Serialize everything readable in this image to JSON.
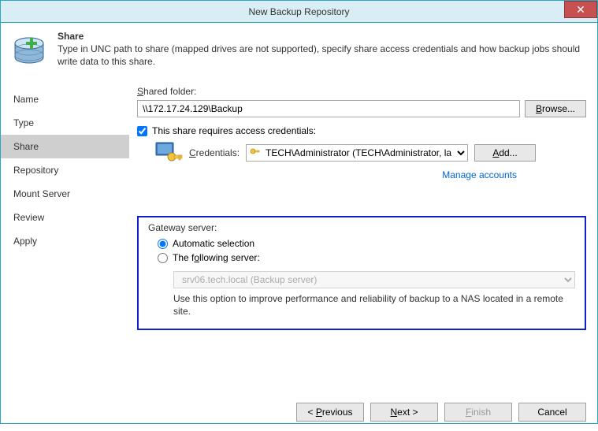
{
  "window": {
    "title": "New Backup Repository",
    "close": "✕"
  },
  "header": {
    "title": "Share",
    "description": "Type in UNC path to share (mapped drives are not supported), specify share access credentials and how backup jobs should write data to this share."
  },
  "sidebar": {
    "items": [
      {
        "label": "Name"
      },
      {
        "label": "Type"
      },
      {
        "label": "Share"
      },
      {
        "label": "Repository"
      },
      {
        "label": "Mount Server"
      },
      {
        "label": "Review"
      },
      {
        "label": "Apply"
      }
    ],
    "active_index": 2
  },
  "form": {
    "shared_folder_label": "Shared folder:",
    "shared_folder_value": "\\\\172.17.24.129\\Backup",
    "browse_label": "Browse...",
    "checkbox_label": "This share requires access credentials:",
    "checkbox_checked": true,
    "credentials_label": "Credentials:",
    "credentials_value": "TECH\\Administrator (TECH\\Administrator, last edite",
    "add_label": "Add...",
    "manage_label": "Manage accounts"
  },
  "gateway": {
    "title": "Gateway server:",
    "auto_label": "Automatic selection",
    "following_label": "The following server:",
    "selected_mode": "auto",
    "server_value": "srv06.tech.local (Backup server)",
    "hint": "Use this option to improve performance and reliability of backup to a NAS located in a remote site."
  },
  "footer": {
    "previous": "< Previous",
    "next": "Next >",
    "finish": "Finish",
    "cancel": "Cancel"
  }
}
